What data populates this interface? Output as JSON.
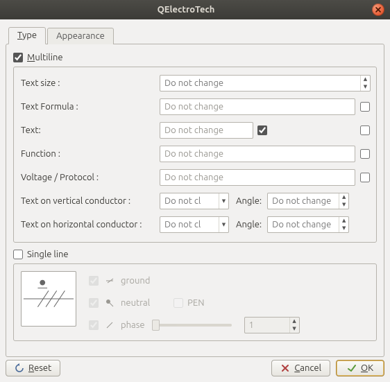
{
  "window": {
    "title": "QElectroTech"
  },
  "tabs": {
    "type": "Type",
    "type_key": "T",
    "appearance": "Appearance"
  },
  "multiline": {
    "label": "ultiline",
    "label_key": "M",
    "checked": true,
    "rows": {
      "text_size": {
        "label": "Text size :",
        "value": "Do not change"
      },
      "formula": {
        "label": "Text Formula :",
        "placeholder": "Do not change"
      },
      "text": {
        "label": "Text:",
        "placeholder": "Do not change",
        "vis_checked": true
      },
      "function": {
        "label": "Function :",
        "placeholder": "Do not change"
      },
      "voltage": {
        "label": "Voltage / Protocol :",
        "placeholder": "Do not change"
      },
      "vcond": {
        "label": "Text on vertical conductor :",
        "value": "Do not cl",
        "angle_label": "Angle:",
        "angle_value": "Do not change"
      },
      "hcond": {
        "label": "Text on horizontal conductor :",
        "value": "Do not cl",
        "angle_label": "Angle:",
        "angle_value": "Do not change"
      }
    }
  },
  "singleline": {
    "label": "Single line",
    "checked": false,
    "ground": {
      "label": "ground",
      "checked": true
    },
    "neutral": {
      "label": "neutral",
      "checked": true
    },
    "pen": {
      "label": "PEN",
      "checked": false
    },
    "phase": {
      "label": "phase",
      "checked": true,
      "count": "1"
    }
  },
  "buttons": {
    "reset": {
      "label": "Reset",
      "key": "R"
    },
    "cancel": {
      "label": "Cancel",
      "key": "C"
    },
    "ok": {
      "label": "OK",
      "key": "O"
    }
  }
}
